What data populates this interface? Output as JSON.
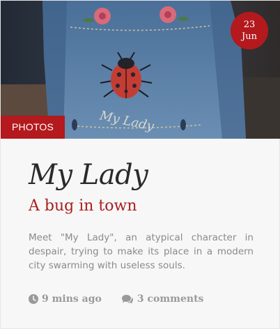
{
  "date": {
    "day": "23",
    "month": "Jun"
  },
  "category": "PHOTOS",
  "photo": {
    "jacket_text": "My Lady"
  },
  "post": {
    "title": "My Lady",
    "subtitle": "A bug in town",
    "excerpt": "Meet \"My Lady\", an atypical character in despair, trying to make its place in a modern city swarming with useless souls."
  },
  "meta": {
    "time": "9 mins ago",
    "comments": "3 comments"
  },
  "colors": {
    "accent": "#b3191d",
    "subtitle": "#a9201f",
    "denim": "#4f79a3"
  },
  "icons": [
    "clock-icon",
    "comments-icon"
  ]
}
